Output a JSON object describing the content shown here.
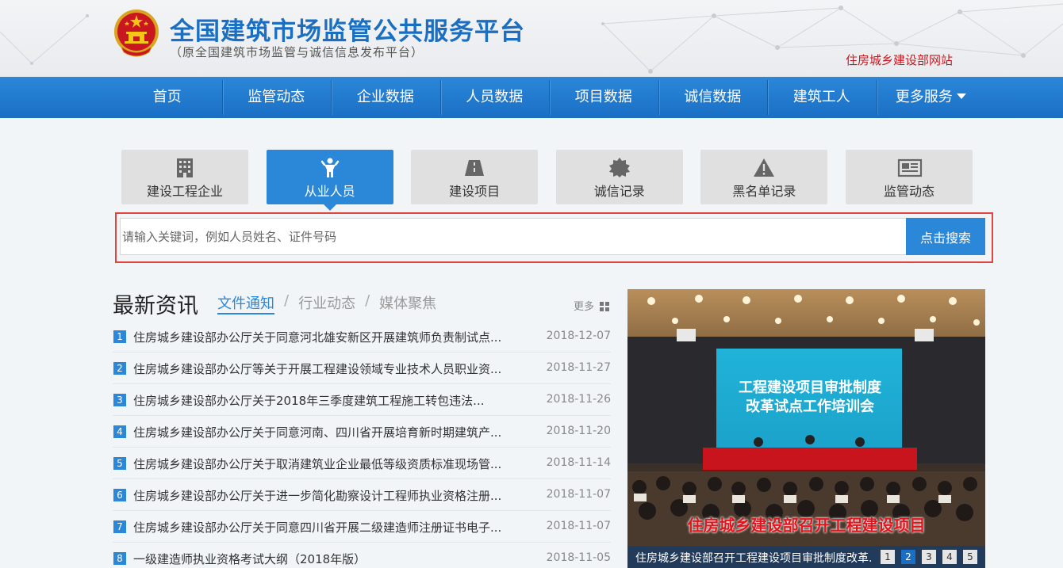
{
  "header": {
    "title": "全国建筑市场监管公共服务平台",
    "subtitle": "（原全国建筑市场监管与诚信信息发布平台）",
    "external_link": "住房城乡建设部网站"
  },
  "nav": {
    "items": [
      {
        "label": "首页"
      },
      {
        "label": "监管动态"
      },
      {
        "label": "企业数据"
      },
      {
        "label": "人员数据"
      },
      {
        "label": "项目数据"
      },
      {
        "label": "诚信数据"
      },
      {
        "label": "建筑工人"
      },
      {
        "label": "更多服务"
      }
    ]
  },
  "category_tabs": [
    {
      "label": "建设工程企业",
      "icon": "building-icon",
      "active": false
    },
    {
      "label": "从业人员",
      "icon": "person-icon",
      "active": true
    },
    {
      "label": "建设项目",
      "icon": "road-icon",
      "active": false
    },
    {
      "label": "诚信记录",
      "icon": "seal-icon",
      "active": false
    },
    {
      "label": "黑名单记录",
      "icon": "warning-icon",
      "active": false
    },
    {
      "label": "监管动态",
      "icon": "newspaper-icon",
      "active": false
    }
  ],
  "search": {
    "placeholder": "请输入关键词，例如人员姓名、证件号码",
    "value": "",
    "button_label": "点击搜索"
  },
  "news": {
    "title": "最新资讯",
    "tabs": [
      {
        "label": "文件通知",
        "active": true
      },
      {
        "label": "行业动态",
        "active": false
      },
      {
        "label": "媒体聚焦",
        "active": false
      }
    ],
    "more_label": "更多",
    "items": [
      {
        "num": "1",
        "title": "住房城乡建设部办公厅关于同意河北雄安新区开展建筑师负责制试点...",
        "date": "2018-12-07"
      },
      {
        "num": "2",
        "title": "住房城乡建设部办公厅等关于开展工程建设领域专业技术人员职业资...",
        "date": "2018-11-27"
      },
      {
        "num": "3",
        "title": "住房城乡建设部办公厅关于2018年三季度建筑工程施工转包违法...",
        "date": "2018-11-26"
      },
      {
        "num": "4",
        "title": "住房城乡建设部办公厅关于同意河南、四川省开展培育新时期建筑产...",
        "date": "2018-11-20"
      },
      {
        "num": "5",
        "title": "住房城乡建设部办公厅关于取消建筑业企业最低等级资质标准现场管...",
        "date": "2018-11-14"
      },
      {
        "num": "6",
        "title": "住房城乡建设部办公厅关于进一步简化勘察设计工程师执业资格注册...",
        "date": "2018-11-07"
      },
      {
        "num": "7",
        "title": "住房城乡建设部办公厅关于同意四川省开展二级建造师注册证书电子...",
        "date": "2018-11-07"
      },
      {
        "num": "8",
        "title": "一级建造师执业资格考试大纲（2018年版）",
        "date": "2018-11-05"
      }
    ]
  },
  "slider": {
    "screen_text_line1": "工程建设项目审批制度",
    "screen_text_line2": "改革试点工作培训会",
    "banner_text": "住房城乡建设部召开工程建设项目",
    "caption": "住房城乡建设部召开工程建设项目审批制度改革...",
    "dots": [
      "1",
      "2",
      "3",
      "4",
      "5"
    ],
    "active_dot": "2"
  },
  "colors": {
    "brand_blue": "#2b87d8",
    "nav_blue": "#1a6fc5",
    "title_blue": "#1a6fc2",
    "link_red": "#c8171e",
    "highlight_red": "#e0463e"
  }
}
